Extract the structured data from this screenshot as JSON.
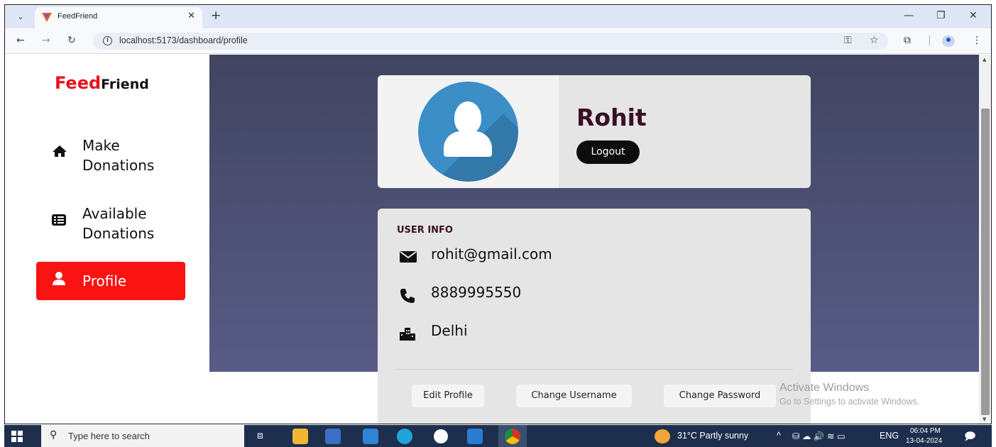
{
  "browser": {
    "tab_title": "FeedFriend",
    "tab_close": "✕",
    "new_tab": "+",
    "url": "localhost:5173/dashboard/profile"
  },
  "brand": {
    "part1": "Feed",
    "part2": "Friend"
  },
  "sidebar": {
    "items": [
      {
        "label": "Make Donations",
        "icon": "home-icon"
      },
      {
        "label": "Available Donations",
        "icon": "list-icon"
      },
      {
        "label": "Profile",
        "icon": "user-icon",
        "active": true
      }
    ]
  },
  "profile": {
    "name": "Rohit",
    "logout_label": "Logout"
  },
  "user_info": {
    "heading": "USER INFO",
    "email": "rohit@gmail.com",
    "phone": "8889995550",
    "city": "Delhi"
  },
  "actions": {
    "edit_profile": "Edit Profile",
    "change_username": "Change Username",
    "change_password": "Change Password"
  },
  "watermark": {
    "line1": "Activate Windows",
    "line2": "Go to Settings to activate Windows."
  },
  "taskbar": {
    "search_placeholder": "Type here to search",
    "weather": "31°C  Partly sunny",
    "language": "ENG",
    "time": "06:04 PM",
    "date": "13-04-2024"
  },
  "colors": {
    "brand_red": "#e8121d",
    "active_nav": "#fa1313",
    "main_bg_top": "#414561",
    "main_bg_bottom": "#585b86",
    "name_color": "#3a0f24",
    "avatar_blue": "#3b8ec6"
  }
}
